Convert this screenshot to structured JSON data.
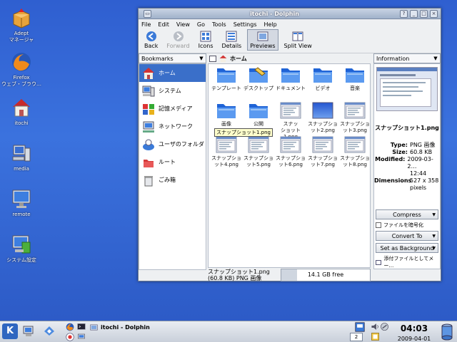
{
  "desktop": {
    "icons": [
      {
        "label": "Adept\nマネージャ"
      },
      {
        "label": "Firefox\nウェブ・ブラウ…"
      },
      {
        "label": "itochi"
      },
      {
        "label": "media"
      },
      {
        "label": "remote"
      },
      {
        "label": "システム設定"
      }
    ]
  },
  "window": {
    "title": "itochi - Dolphin",
    "menu": [
      "File",
      "Edit",
      "View",
      "Go",
      "Tools",
      "Settings",
      "Help"
    ],
    "toolbar": {
      "back": "Back",
      "forward": "Forward",
      "icons": "Icons",
      "details": "Details",
      "previews": "Previews",
      "split": "Split View"
    },
    "places_header": "Bookmarks",
    "places": [
      "ホーム",
      "システム",
      "記憶メディア",
      "ネットワーク",
      "ユーザのフォルダ",
      "ルート",
      "ごみ箱"
    ],
    "path": "ホーム",
    "files": [
      {
        "name": "テンプレート",
        "type": "folder"
      },
      {
        "name": "デスクトップ",
        "type": "desktop"
      },
      {
        "name": "ドキュメント",
        "type": "folder"
      },
      {
        "name": "ビデオ",
        "type": "folder"
      },
      {
        "name": "音楽",
        "type": "folder"
      },
      {
        "name": "画像",
        "type": "folder"
      },
      {
        "name": "公開",
        "type": "folder"
      },
      {
        "name": "スナッ\nショット1.png",
        "type": "shot"
      },
      {
        "name": "スナップショ\nット2.png",
        "type": "blue"
      },
      {
        "name": "スナップショ\nット3.png",
        "type": "shot"
      },
      {
        "name": "スナップショ\nット4.png",
        "type": "shot"
      },
      {
        "name": "スナップショ\nット5.png",
        "type": "shot"
      },
      {
        "name": "スナップショ\nット6.png",
        "type": "shot"
      },
      {
        "name": "スナップショ\nット7.png",
        "type": "shot"
      },
      {
        "name": "スナップショ\nット8.png",
        "type": "shot"
      }
    ],
    "tooltip": "スナップショット1.png",
    "status_text": "スナップショット1.png (60.8 KB)  PNG 画像",
    "free_space": "14.1 GB free",
    "info_header": "Information",
    "info": {
      "filename": "スナップショット1.png",
      "type_k": "Type:",
      "type_v": "PNG 画像",
      "size_k": "Size:",
      "size_v": "60.8 KB",
      "modified_k": "Modified:",
      "modified_v": "2009-03-2…",
      "modified_v2": "12:44",
      "dims_k": "Dimensions",
      "dims_v": "527 x 358",
      "dims_v2": "pixels"
    },
    "actions": {
      "compress": "Compress",
      "encrypt": "ファイルを暗号化",
      "convert": "Convert To",
      "background": "Set as Background",
      "attach": "添付ファイルとしてメー…"
    }
  },
  "taskbar": {
    "task_title": "itochi - Dolphin",
    "pager": "2",
    "time": "04:03",
    "date": "2009-04-01"
  }
}
